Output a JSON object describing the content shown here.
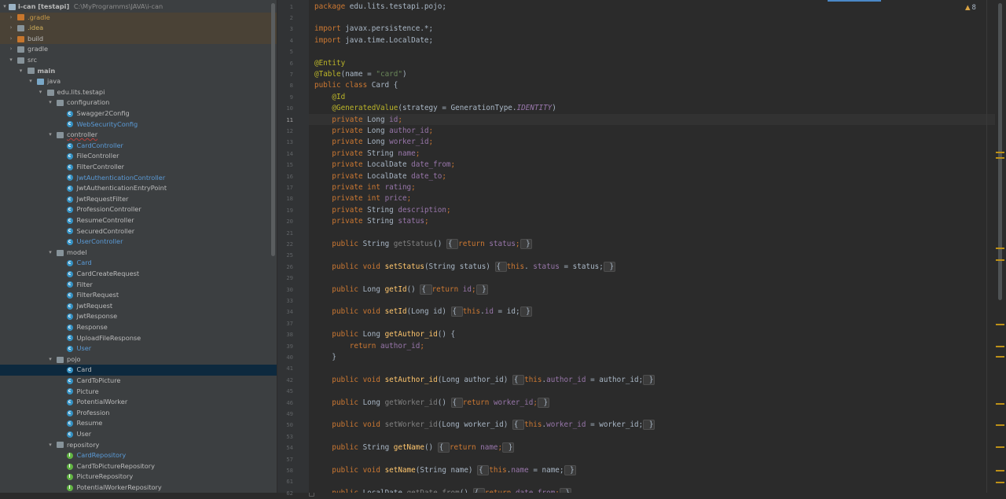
{
  "project_tree": {
    "root": {
      "name": "i-can [testapi]",
      "path": "C:\\MyProgramms\\JAVA\\i-can"
    },
    "items": [
      {
        "label": ".gradle",
        "depth": 1,
        "arrow": "right",
        "icon": "folder-orange",
        "style": "orange",
        "excluded": true
      },
      {
        "label": ".idea",
        "depth": 1,
        "arrow": "right",
        "icon": "folder",
        "style": "yellow",
        "excluded": true
      },
      {
        "label": "build",
        "depth": 1,
        "arrow": "right",
        "icon": "folder-orange",
        "style": "normal",
        "excluded": true
      },
      {
        "label": "gradle",
        "depth": 1,
        "arrow": "right",
        "icon": "folder",
        "style": "normal"
      },
      {
        "label": "src",
        "depth": 1,
        "arrow": "down",
        "icon": "folder",
        "style": "normal"
      },
      {
        "label": "main",
        "depth": 2,
        "arrow": "down",
        "icon": "folder",
        "style": "bold"
      },
      {
        "label": "java",
        "depth": 3,
        "arrow": "down",
        "icon": "folder-blue",
        "style": "normal"
      },
      {
        "label": "edu.lits.testapi",
        "depth": 4,
        "arrow": "down",
        "icon": "pkg",
        "style": "normal"
      },
      {
        "label": "configuration",
        "depth": 5,
        "arrow": "down",
        "icon": "pkg",
        "style": "normal"
      },
      {
        "label": "Swagger2Config",
        "depth": 6,
        "icon": "class",
        "style": "normal"
      },
      {
        "label": "WebSecurityConfig",
        "depth": 6,
        "icon": "class",
        "style": "blue"
      },
      {
        "label": "controller",
        "depth": 5,
        "arrow": "down",
        "icon": "pkg",
        "style": "strike"
      },
      {
        "label": "CardController",
        "depth": 6,
        "icon": "class",
        "style": "blue"
      },
      {
        "label": "FileController",
        "depth": 6,
        "icon": "class",
        "style": "normal"
      },
      {
        "label": "FilterController",
        "depth": 6,
        "icon": "class",
        "style": "normal"
      },
      {
        "label": "JwtAuthenticationController",
        "depth": 6,
        "icon": "class",
        "style": "blue"
      },
      {
        "label": "JwtAuthenticationEntryPoint",
        "depth": 6,
        "icon": "class",
        "style": "normal"
      },
      {
        "label": "JwtRequestFilter",
        "depth": 6,
        "icon": "class",
        "style": "normal"
      },
      {
        "label": "ProfessionController",
        "depth": 6,
        "icon": "class",
        "style": "normal"
      },
      {
        "label": "ResumeController",
        "depth": 6,
        "icon": "class",
        "style": "normal"
      },
      {
        "label": "SecuredController",
        "depth": 6,
        "icon": "class",
        "style": "normal"
      },
      {
        "label": "UserController",
        "depth": 6,
        "icon": "class",
        "style": "blue"
      },
      {
        "label": "model",
        "depth": 5,
        "arrow": "down",
        "icon": "pkg",
        "style": "normal"
      },
      {
        "label": "Card",
        "depth": 6,
        "icon": "class",
        "style": "blue"
      },
      {
        "label": "CardCreateRequest",
        "depth": 6,
        "icon": "class",
        "style": "normal"
      },
      {
        "label": "Filter",
        "depth": 6,
        "icon": "class",
        "style": "normal"
      },
      {
        "label": "FilterRequest",
        "depth": 6,
        "icon": "class",
        "style": "normal"
      },
      {
        "label": "JwtRequest",
        "depth": 6,
        "icon": "class",
        "style": "normal"
      },
      {
        "label": "JwtResponse",
        "depth": 6,
        "icon": "class",
        "style": "normal"
      },
      {
        "label": "Response",
        "depth": 6,
        "icon": "class",
        "style": "normal"
      },
      {
        "label": "UploadFileResponse",
        "depth": 6,
        "icon": "class",
        "style": "normal"
      },
      {
        "label": "User",
        "depth": 6,
        "icon": "class",
        "style": "blue"
      },
      {
        "label": "pojo",
        "depth": 5,
        "arrow": "down",
        "icon": "pkg",
        "style": "normal"
      },
      {
        "label": "Card",
        "depth": 6,
        "icon": "class",
        "style": "normal",
        "selected": true
      },
      {
        "label": "CardToPicture",
        "depth": 6,
        "icon": "class",
        "style": "normal"
      },
      {
        "label": "Picture",
        "depth": 6,
        "icon": "class",
        "style": "normal"
      },
      {
        "label": "PotentialWorker",
        "depth": 6,
        "icon": "class",
        "style": "normal"
      },
      {
        "label": "Profession",
        "depth": 6,
        "icon": "class",
        "style": "normal"
      },
      {
        "label": "Resume",
        "depth": 6,
        "icon": "class",
        "style": "normal"
      },
      {
        "label": "User",
        "depth": 6,
        "icon": "class",
        "style": "normal"
      },
      {
        "label": "repository",
        "depth": 5,
        "arrow": "down",
        "icon": "pkg",
        "style": "normal"
      },
      {
        "label": "CardRepository",
        "depth": 6,
        "icon": "iface",
        "style": "blue"
      },
      {
        "label": "CardToPictureRepository",
        "depth": 6,
        "icon": "iface",
        "style": "normal"
      },
      {
        "label": "PictureRepository",
        "depth": 6,
        "icon": "iface",
        "style": "normal"
      },
      {
        "label": "PotentialWorkerRepository",
        "depth": 6,
        "icon": "iface",
        "style": "normal"
      }
    ]
  },
  "editor": {
    "warning_count": "8",
    "current_line": "11",
    "line_numbers": [
      "1",
      "2",
      "3",
      "4",
      "5",
      "6",
      "7",
      "8",
      "9",
      "10",
      "11",
      "12",
      "13",
      "14",
      "15",
      "16",
      "17",
      "18",
      "19",
      "20",
      "21",
      "22",
      "25",
      "26",
      "29",
      "30",
      "33",
      "34",
      "37",
      "38",
      "39",
      "40",
      "41",
      "42",
      "45",
      "46",
      "49",
      "50",
      "53",
      "54",
      "57",
      "58",
      "61",
      "62"
    ],
    "lines": [
      [
        [
          "kw",
          "package "
        ],
        [
          "",
          "edu.lits.testapi.pojo;"
        ]
      ],
      [],
      [
        [
          "kw",
          "import "
        ],
        [
          "",
          "javax.persistence.*;"
        ]
      ],
      [
        [
          "kw",
          "import "
        ],
        [
          "",
          "java.time.LocalDate;"
        ]
      ],
      [],
      [
        [
          "ann",
          "@Entity"
        ]
      ],
      [
        [
          "ann",
          "@Table"
        ],
        [
          "",
          "(name = "
        ],
        [
          "str",
          "\"card\""
        ],
        [
          "",
          ")"
        ]
      ],
      [
        [
          "kw",
          "public class "
        ],
        [
          "",
          "Card {"
        ]
      ],
      [
        [
          "",
          "    "
        ],
        [
          "ann",
          "@Id"
        ]
      ],
      [
        [
          "",
          "    "
        ],
        [
          "ann",
          "@GeneratedValue"
        ],
        [
          "",
          "(strategy = GenerationType."
        ],
        [
          "st",
          "IDENTITY"
        ],
        [
          "",
          ")"
        ]
      ],
      [
        [
          "",
          "    "
        ],
        [
          "kw",
          "private "
        ],
        [
          "",
          "Long "
        ],
        [
          "fld",
          "id"
        ],
        [
          "kw",
          ";"
        ]
      ],
      [
        [
          "",
          "    "
        ],
        [
          "kw",
          "private "
        ],
        [
          "",
          "Long "
        ],
        [
          "fld",
          "author_id"
        ],
        [
          "kw",
          ";"
        ]
      ],
      [
        [
          "",
          "    "
        ],
        [
          "kw",
          "private "
        ],
        [
          "",
          "Long "
        ],
        [
          "fld",
          "worker_id"
        ],
        [
          "kw",
          ";"
        ]
      ],
      [
        [
          "",
          "    "
        ],
        [
          "kw",
          "private "
        ],
        [
          "",
          "String "
        ],
        [
          "fld",
          "name"
        ],
        [
          "kw",
          ";"
        ]
      ],
      [
        [
          "",
          "    "
        ],
        [
          "kw",
          "private "
        ],
        [
          "",
          "LocalDate "
        ],
        [
          "fld",
          "date_from"
        ],
        [
          "kw",
          ";"
        ]
      ],
      [
        [
          "",
          "    "
        ],
        [
          "kw",
          "private "
        ],
        [
          "",
          "LocalDate "
        ],
        [
          "fld",
          "date_to"
        ],
        [
          "kw",
          ";"
        ]
      ],
      [
        [
          "",
          "    "
        ],
        [
          "kw",
          "private int "
        ],
        [
          "fld",
          "rating"
        ],
        [
          "kw",
          ";"
        ]
      ],
      [
        [
          "",
          "    "
        ],
        [
          "kw",
          "private int "
        ],
        [
          "fld",
          "price"
        ],
        [
          "kw",
          ";"
        ]
      ],
      [
        [
          "",
          "    "
        ],
        [
          "kw",
          "private "
        ],
        [
          "",
          "String "
        ],
        [
          "fld",
          "description"
        ],
        [
          "kw",
          ";"
        ]
      ],
      [
        [
          "",
          "    "
        ],
        [
          "kw",
          "private "
        ],
        [
          "",
          "String "
        ],
        [
          "fld",
          "status"
        ],
        [
          "kw",
          ";"
        ]
      ],
      [],
      [
        [
          "",
          "    "
        ],
        [
          "kw",
          "public "
        ],
        [
          "",
          "String "
        ],
        [
          "gray",
          "getStatus"
        ],
        [
          "",
          "() "
        ],
        [
          "fold",
          "{ "
        ],
        [
          "kw",
          "return "
        ],
        [
          "fld",
          "status"
        ],
        [
          "kw",
          ";"
        ],
        [
          "fold",
          " }"
        ]
      ],
      [],
      [
        [
          "",
          "    "
        ],
        [
          "kw",
          "public void "
        ],
        [
          "mth",
          "setStatus"
        ],
        [
          "",
          "(String status) "
        ],
        [
          "fold",
          "{ "
        ],
        [
          "kw",
          "this"
        ],
        [
          "",
          ". "
        ],
        [
          "fld",
          "status"
        ],
        [
          "",
          " = status;"
        ],
        [
          "fold",
          " }"
        ]
      ],
      [],
      [
        [
          "",
          "    "
        ],
        [
          "kw",
          "public "
        ],
        [
          "",
          "Long "
        ],
        [
          "mth",
          "getId"
        ],
        [
          "",
          "() "
        ],
        [
          "fold",
          "{ "
        ],
        [
          "kw",
          "return "
        ],
        [
          "fld",
          "id"
        ],
        [
          "kw",
          ";"
        ],
        [
          "fold",
          " }"
        ]
      ],
      [],
      [
        [
          "",
          "    "
        ],
        [
          "kw",
          "public void "
        ],
        [
          "mth",
          "setId"
        ],
        [
          "",
          "(Long id) "
        ],
        [
          "fold",
          "{ "
        ],
        [
          "kw",
          "this"
        ],
        [
          "",
          "."
        ],
        [
          "fld",
          "id"
        ],
        [
          "",
          " = id;"
        ],
        [
          "fold",
          " }"
        ]
      ],
      [],
      [
        [
          "",
          "    "
        ],
        [
          "kw",
          "public "
        ],
        [
          "",
          "Long "
        ],
        [
          "mth",
          "getAuthor_id"
        ],
        [
          "",
          "() {"
        ]
      ],
      [
        [
          "",
          "        "
        ],
        [
          "kw",
          "return "
        ],
        [
          "fld",
          "author_id"
        ],
        [
          "kw",
          ";"
        ]
      ],
      [
        [
          "",
          "    }"
        ]
      ],
      [],
      [
        [
          "",
          "    "
        ],
        [
          "kw",
          "public void "
        ],
        [
          "mth",
          "setAuthor_id"
        ],
        [
          "",
          "(Long author_id) "
        ],
        [
          "fold",
          "{ "
        ],
        [
          "kw",
          "this"
        ],
        [
          "",
          "."
        ],
        [
          "fld",
          "author_id"
        ],
        [
          "",
          " = author_id;"
        ],
        [
          "fold",
          " }"
        ]
      ],
      [],
      [
        [
          "",
          "    "
        ],
        [
          "kw",
          "public "
        ],
        [
          "",
          "Long "
        ],
        [
          "gray",
          "getWorker_id"
        ],
        [
          "",
          "() "
        ],
        [
          "fold",
          "{ "
        ],
        [
          "kw",
          "return "
        ],
        [
          "fld",
          "worker_id"
        ],
        [
          "kw",
          ";"
        ],
        [
          "fold",
          " }"
        ]
      ],
      [],
      [
        [
          "",
          "    "
        ],
        [
          "kw",
          "public void "
        ],
        [
          "gray",
          "setWorker_id"
        ],
        [
          "",
          "(Long worker_id) "
        ],
        [
          "fold",
          "{ "
        ],
        [
          "kw",
          "this"
        ],
        [
          "",
          "."
        ],
        [
          "fld",
          "worker_id"
        ],
        [
          "",
          " = worker_id;"
        ],
        [
          "fold",
          " }"
        ]
      ],
      [],
      [
        [
          "",
          "    "
        ],
        [
          "kw",
          "public "
        ],
        [
          "",
          "String "
        ],
        [
          "mth",
          "getName"
        ],
        [
          "",
          "() "
        ],
        [
          "fold",
          "{ "
        ],
        [
          "kw",
          "return "
        ],
        [
          "fld",
          "name"
        ],
        [
          "kw",
          ";"
        ],
        [
          "fold",
          " }"
        ]
      ],
      [],
      [
        [
          "",
          "    "
        ],
        [
          "kw",
          "public void "
        ],
        [
          "mth",
          "setName"
        ],
        [
          "",
          "(String name) "
        ],
        [
          "fold",
          "{ "
        ],
        [
          "kw",
          "this"
        ],
        [
          "",
          "."
        ],
        [
          "fld",
          "name"
        ],
        [
          "",
          " = name;"
        ],
        [
          "fold",
          " }"
        ]
      ],
      [],
      [
        [
          "",
          "    "
        ],
        [
          "kw",
          "public "
        ],
        [
          "",
          "LocalDate "
        ],
        [
          "gray",
          "getDate_from"
        ],
        [
          "",
          "() "
        ],
        [
          "fold",
          "{ "
        ],
        [
          "kw",
          "return "
        ],
        [
          "fld",
          "date_from"
        ],
        [
          "kw",
          ";"
        ],
        [
          "fold",
          " }"
        ]
      ]
    ]
  },
  "colors": {
    "tree_bg": "#3c3f41",
    "editor_bg": "#2b2b2b",
    "keyword": "#cc7832",
    "annotation": "#bbb529",
    "string": "#6a8759",
    "field": "#9876aa",
    "method": "#ffc66d",
    "selection": "#0d293e"
  }
}
